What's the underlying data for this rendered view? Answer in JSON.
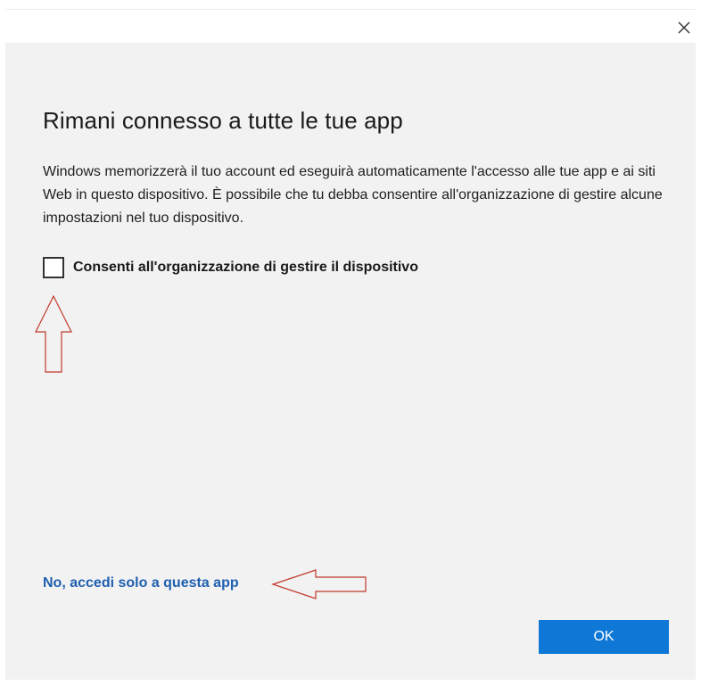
{
  "dialog": {
    "title": "Rimani connesso a tutte le tue app",
    "description": "Windows memorizzerà il tuo account ed eseguirà automaticamente l'accesso alle tue app e ai siti Web in questo dispositivo. È possibile che tu debba consentire all'organizzazione di gestire alcune impostazioni nel tuo dispositivo.",
    "checkbox": {
      "label": "Consenti all'organizzazione di gestire il dispositivo",
      "checked": false
    },
    "link_label": "No, accedi solo a questa app",
    "ok_label": "OK",
    "close_icon": "close-icon"
  },
  "colors": {
    "panel_bg": "#f2f2f2",
    "accent": "#0f78d7",
    "link": "#1f5fb0",
    "annotation_arrow": "#c0392b"
  }
}
